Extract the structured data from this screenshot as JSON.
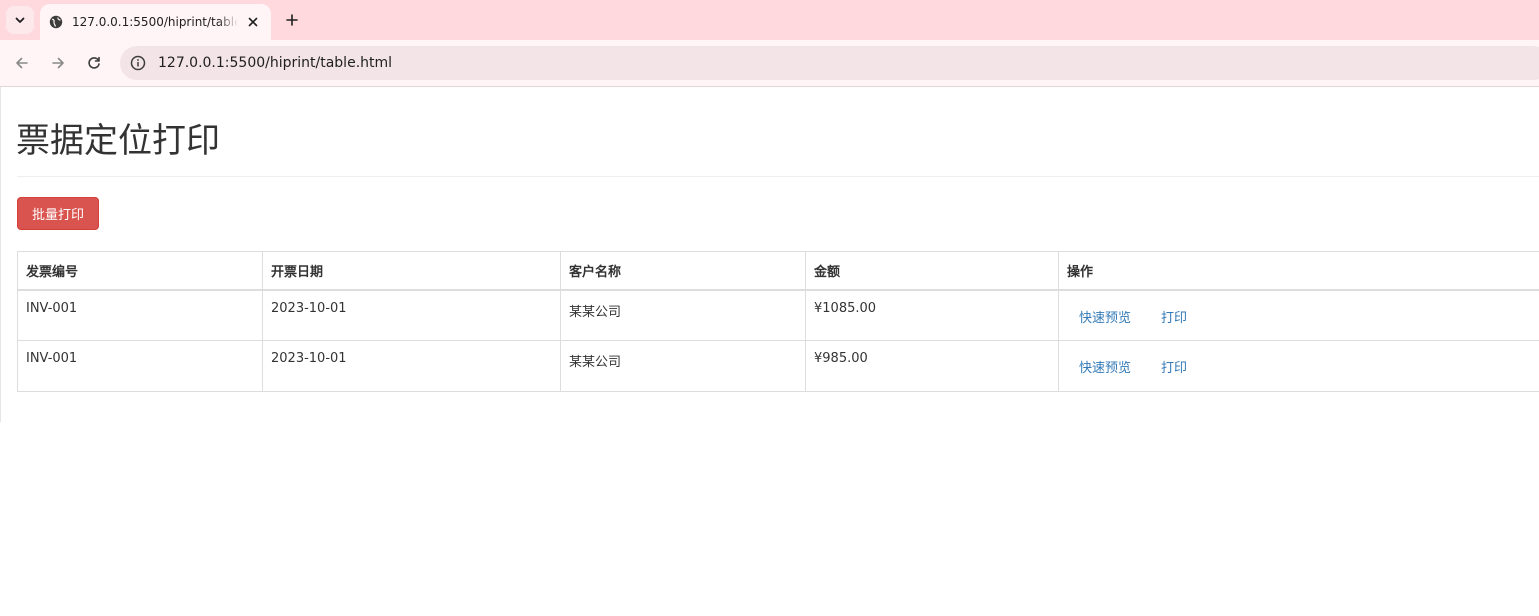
{
  "browser": {
    "tab_title": "127.0.0.1:5500/hiprint/table.html",
    "url": "127.0.0.1:5500/hiprint/table.html",
    "theme_color": "#ffd9de"
  },
  "page": {
    "title": "票据定位打印",
    "batch_print_label": "批量打印"
  },
  "table": {
    "headers": [
      "发票编号",
      "开票日期",
      "客户名称",
      "金额",
      "操作"
    ],
    "rows": [
      {
        "invoice_no": "INV-001",
        "date": "2023-10-01",
        "customer": "某某公司",
        "amount": "¥1085.00",
        "preview_label": "快速预览",
        "print_label": "打印"
      },
      {
        "invoice_no": "INV-001",
        "date": "2023-10-01",
        "customer": "某某公司",
        "amount": "¥985.00",
        "preview_label": "快速预览",
        "print_label": "打印"
      }
    ]
  },
  "colors": {
    "danger_button": "#d9534f",
    "link": "#337ab7"
  }
}
